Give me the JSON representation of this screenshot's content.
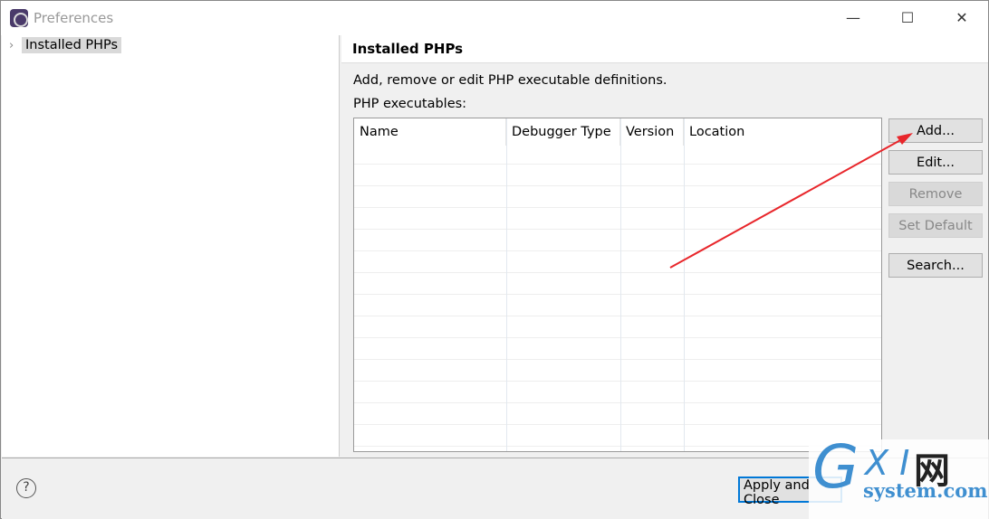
{
  "window": {
    "title": "Preferences",
    "minimize": "—",
    "maximize": "☐",
    "close": "✕"
  },
  "sidebar": {
    "items": [
      {
        "label": "Installed PHPs",
        "expander": "›"
      }
    ]
  },
  "main": {
    "title": "Installed PHPs",
    "description": "Add, remove or edit PHP executable definitions.",
    "table_label": "PHP executables:",
    "columns": [
      "Name",
      "Debugger Type",
      "Version",
      "Location"
    ],
    "rows": []
  },
  "buttons": {
    "add": "Add...",
    "edit": "Edit...",
    "remove": "Remove",
    "set_default": "Set Default",
    "search": "Search..."
  },
  "footer": {
    "help": "?",
    "apply_close": "Apply and Close"
  },
  "watermark": {
    "logo": "GXI网",
    "sub": "system.com"
  },
  "annotation": {
    "arrow_color": "#e8262b"
  }
}
